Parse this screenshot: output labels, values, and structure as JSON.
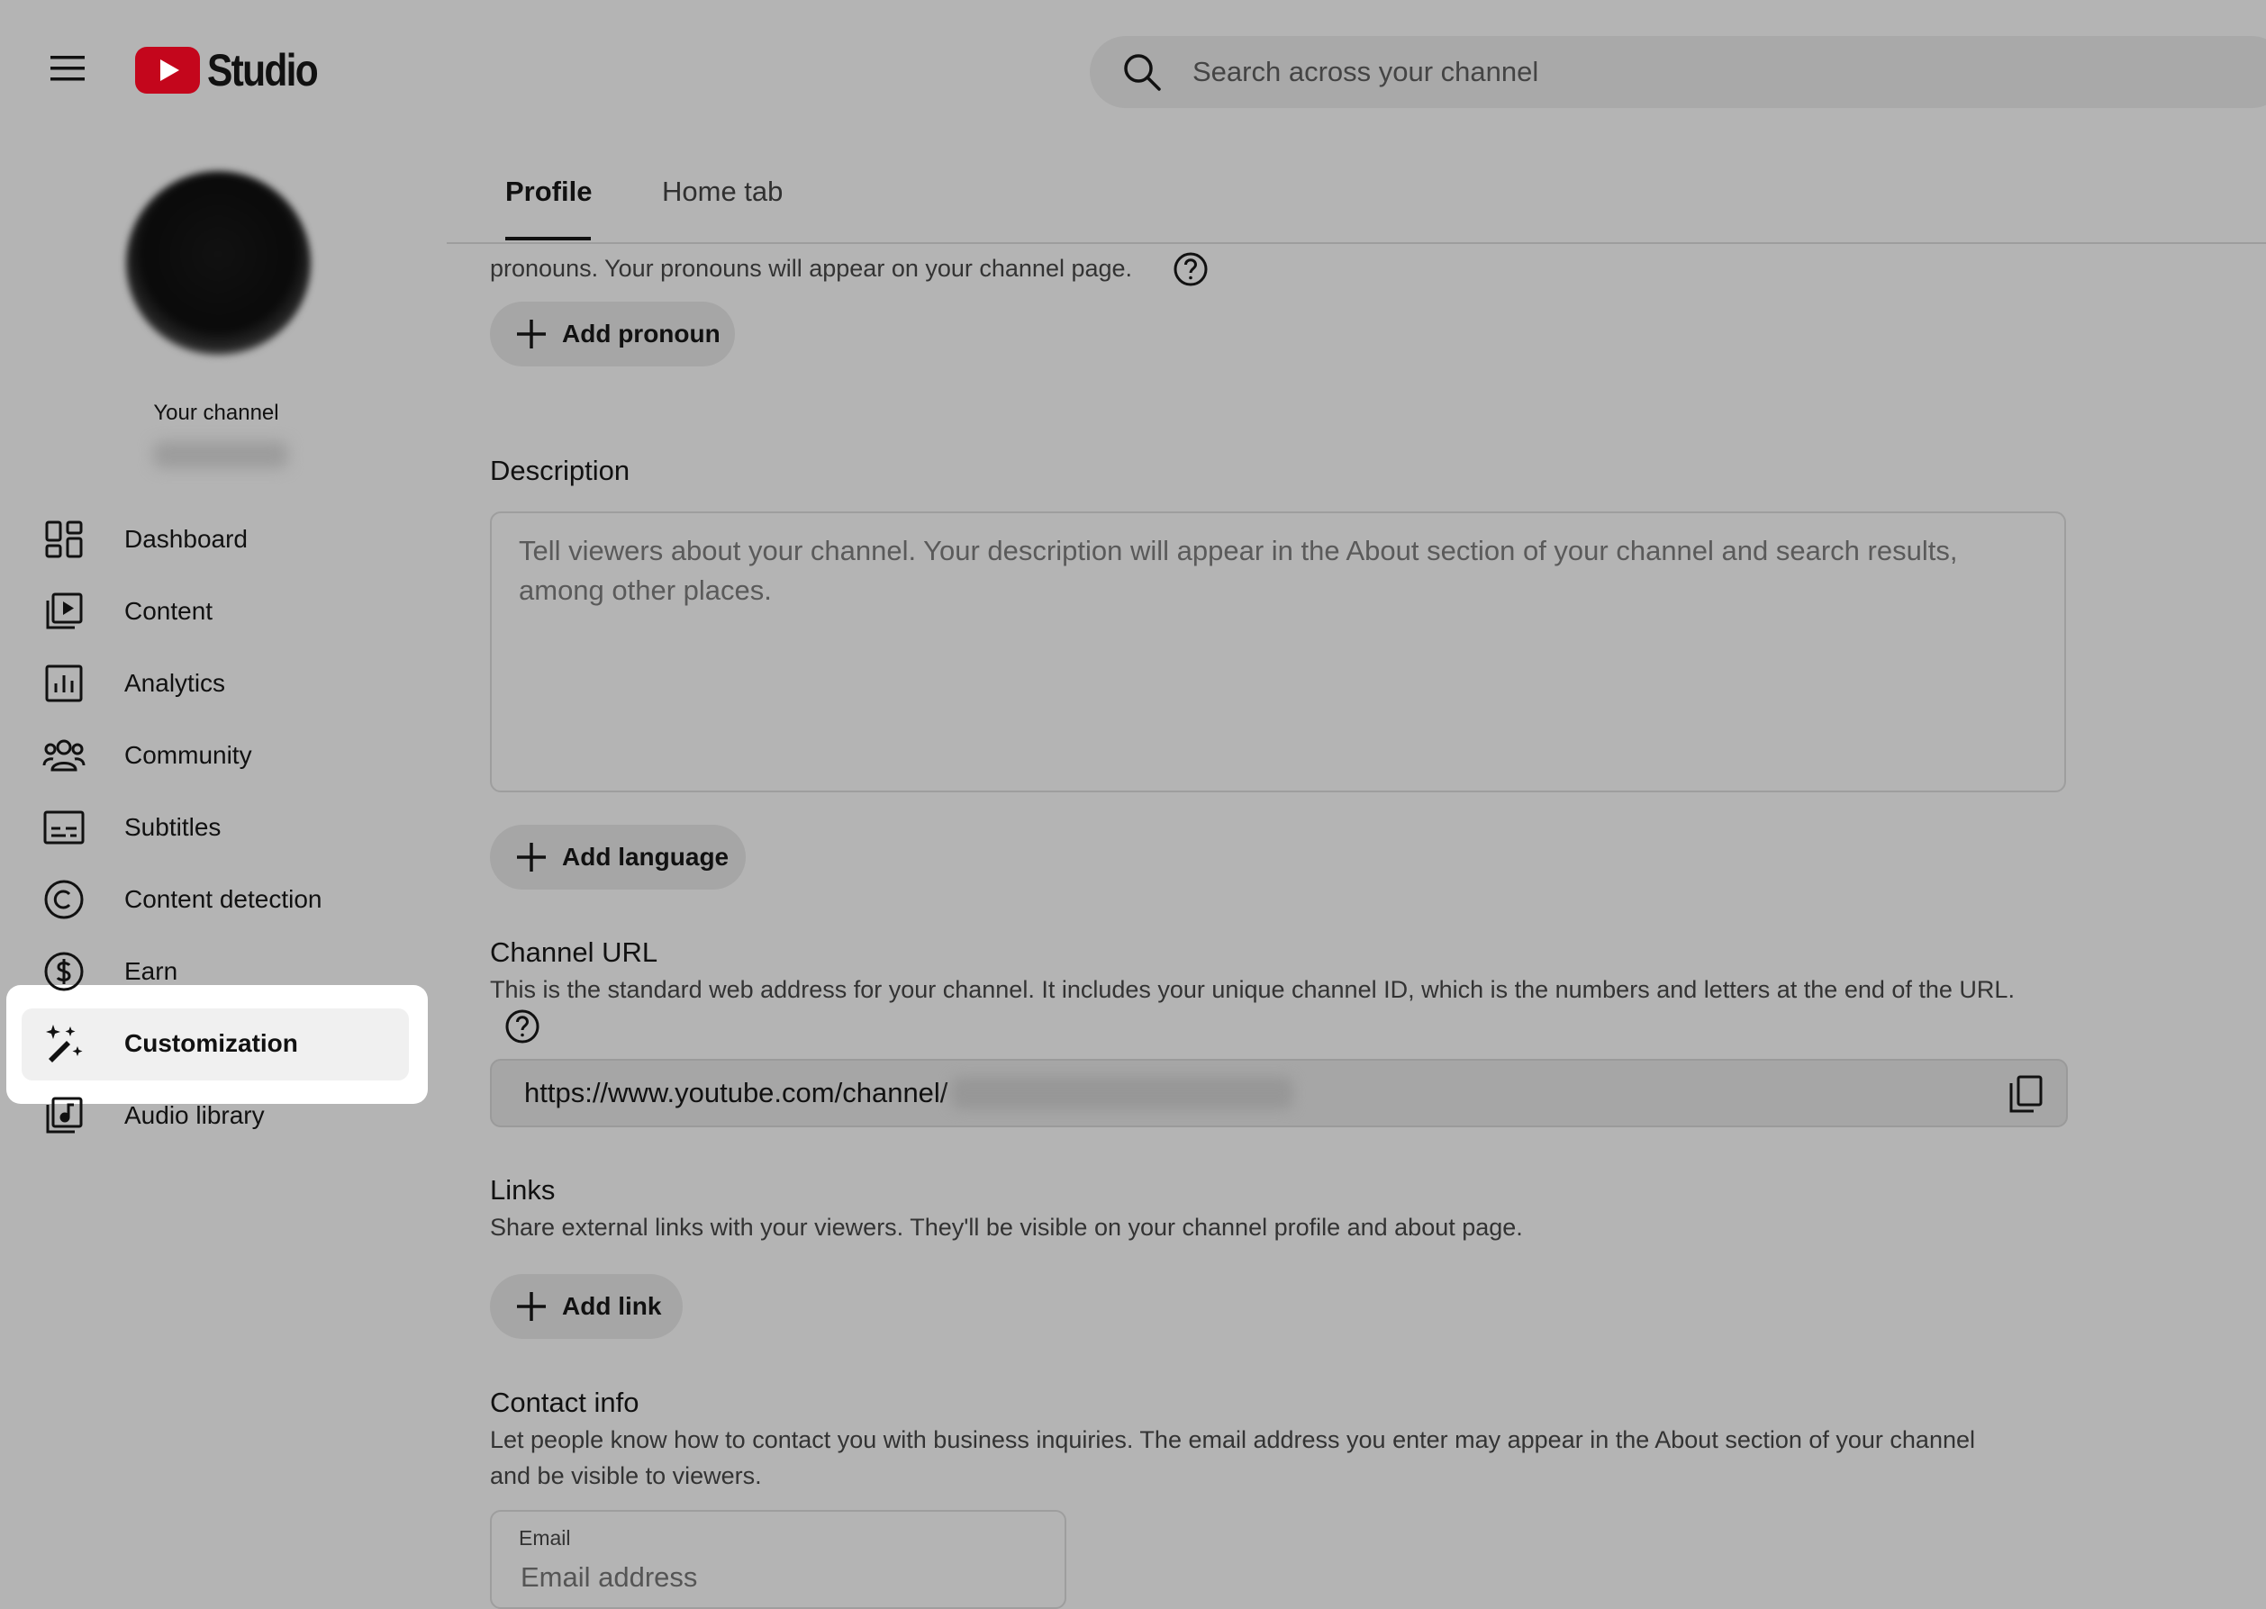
{
  "header": {
    "logo_text": "Studio",
    "search_placeholder": "Search across your channel"
  },
  "sidebar": {
    "channel_label": "Your channel",
    "items": [
      {
        "label": "Dashboard",
        "icon": "dashboard-icon"
      },
      {
        "label": "Content",
        "icon": "content-icon"
      },
      {
        "label": "Analytics",
        "icon": "analytics-icon"
      },
      {
        "label": "Community",
        "icon": "community-icon"
      },
      {
        "label": "Subtitles",
        "icon": "subtitles-icon"
      },
      {
        "label": "Content detection",
        "icon": "copyright-icon"
      },
      {
        "label": "Earn",
        "icon": "dollar-icon"
      },
      {
        "label": "Customization",
        "icon": "magic-wand-icon",
        "active": true
      },
      {
        "label": "Audio library",
        "icon": "audio-library-icon"
      }
    ]
  },
  "tabs": {
    "profile": "Profile",
    "home": "Home tab"
  },
  "pronouns": {
    "text": "pronouns. Your pronouns will appear on your channel page.",
    "add_label": "Add pronoun"
  },
  "description": {
    "title": "Description",
    "placeholder": "Tell viewers about your channel. Your description will appear in the About section of your channel and search results, among other places.",
    "add_language_label": "Add language"
  },
  "channel_url": {
    "title": "Channel URL",
    "help_text": "This is the standard web address for your channel. It includes your unique channel ID, which is the numbers and letters at the end of the URL.",
    "url_prefix": "https://www.youtube.com/channel/"
  },
  "links": {
    "title": "Links",
    "help_text": "Share external links with your viewers. They'll be visible on your channel profile and about page.",
    "add_label": "Add link"
  },
  "contact": {
    "title": "Contact info",
    "help_text_line1": "Let people know how to contact you with business inquiries. The email address you enter may appear in the About section of your channel",
    "help_text_line2": "and be visible to viewers.",
    "email_label": "Email",
    "email_placeholder": "Email address"
  },
  "colors": {
    "brand_red": "#c4061c",
    "background": "#b4b4b4",
    "highlight": "#ffffff"
  }
}
